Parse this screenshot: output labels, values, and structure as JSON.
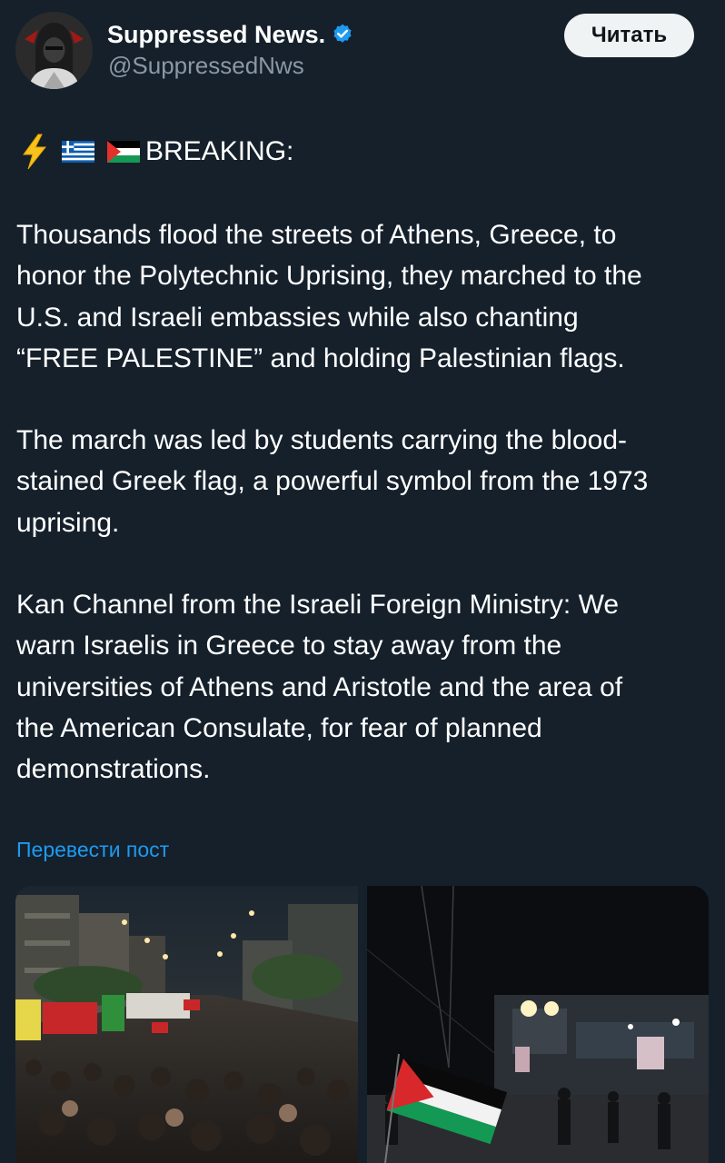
{
  "header": {
    "display_name": "Suppressed News.",
    "handle": "@SuppressedNws",
    "follow_label": "Читать",
    "avatar_icon": "hooded-figure-avatar",
    "verified_icon": "verified-badge-icon",
    "verified_color": "#1d9bf0"
  },
  "tweet": {
    "breaking_icons": [
      "lightning-icon",
      "greece-flag-icon",
      "palestine-flag-icon"
    ],
    "breaking_label": "BREAKING:",
    "paragraphs": [
      "Thousands flood the streets of Athens, Greece, to\nhonor the Polytechnic Uprising, they marched to the\nU.S. and Israeli embassies while also chanting\n“FREE PALESTINE” and holding Palestinian flags.",
      "The march was led by students carrying the blood-\nstained Greek flag, a powerful symbol from the 1973\nuprising.",
      "Kan Channel from the Israeli Foreign Ministry: We\nwarn Israelis in Greece to stay away from the\nuniversities of Athens and Aristotle and the area of\nthe American Consulate, for fear of planned\ndemonstrations."
    ],
    "translate_label": "Перевести пост"
  },
  "media": [
    {
      "kind": "photo",
      "subject": "night-street-march-crowd-with-flags"
    },
    {
      "kind": "photo",
      "subject": "night-street-with-palestinian-flag"
    }
  ],
  "colors": {
    "background": "#15202b",
    "text": "#ffffff",
    "secondary_text": "#8b98a5",
    "link": "#1d9bf0",
    "button_bg": "#eff3f4",
    "button_text": "#0f1419"
  }
}
